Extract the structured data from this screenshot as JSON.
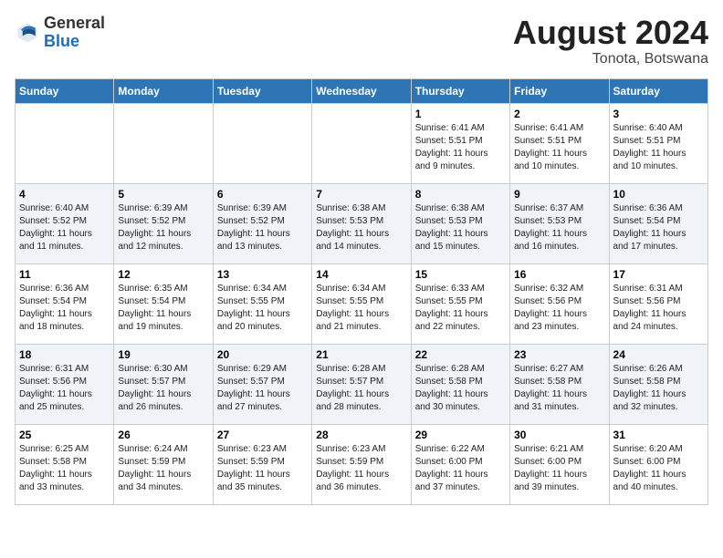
{
  "header": {
    "logo_general": "General",
    "logo_blue": "Blue",
    "month_year": "August 2024",
    "location": "Tonota, Botswana"
  },
  "days_of_week": [
    "Sunday",
    "Monday",
    "Tuesday",
    "Wednesday",
    "Thursday",
    "Friday",
    "Saturday"
  ],
  "weeks": [
    [
      {
        "day": "",
        "info": ""
      },
      {
        "day": "",
        "info": ""
      },
      {
        "day": "",
        "info": ""
      },
      {
        "day": "",
        "info": ""
      },
      {
        "day": "1",
        "info": "Sunrise: 6:41 AM\nSunset: 5:51 PM\nDaylight: 11 hours\nand 9 minutes."
      },
      {
        "day": "2",
        "info": "Sunrise: 6:41 AM\nSunset: 5:51 PM\nDaylight: 11 hours\nand 10 minutes."
      },
      {
        "day": "3",
        "info": "Sunrise: 6:40 AM\nSunset: 5:51 PM\nDaylight: 11 hours\nand 10 minutes."
      }
    ],
    [
      {
        "day": "4",
        "info": "Sunrise: 6:40 AM\nSunset: 5:52 PM\nDaylight: 11 hours\nand 11 minutes."
      },
      {
        "day": "5",
        "info": "Sunrise: 6:39 AM\nSunset: 5:52 PM\nDaylight: 11 hours\nand 12 minutes."
      },
      {
        "day": "6",
        "info": "Sunrise: 6:39 AM\nSunset: 5:52 PM\nDaylight: 11 hours\nand 13 minutes."
      },
      {
        "day": "7",
        "info": "Sunrise: 6:38 AM\nSunset: 5:53 PM\nDaylight: 11 hours\nand 14 minutes."
      },
      {
        "day": "8",
        "info": "Sunrise: 6:38 AM\nSunset: 5:53 PM\nDaylight: 11 hours\nand 15 minutes."
      },
      {
        "day": "9",
        "info": "Sunrise: 6:37 AM\nSunset: 5:53 PM\nDaylight: 11 hours\nand 16 minutes."
      },
      {
        "day": "10",
        "info": "Sunrise: 6:36 AM\nSunset: 5:54 PM\nDaylight: 11 hours\nand 17 minutes."
      }
    ],
    [
      {
        "day": "11",
        "info": "Sunrise: 6:36 AM\nSunset: 5:54 PM\nDaylight: 11 hours\nand 18 minutes."
      },
      {
        "day": "12",
        "info": "Sunrise: 6:35 AM\nSunset: 5:54 PM\nDaylight: 11 hours\nand 19 minutes."
      },
      {
        "day": "13",
        "info": "Sunrise: 6:34 AM\nSunset: 5:55 PM\nDaylight: 11 hours\nand 20 minutes."
      },
      {
        "day": "14",
        "info": "Sunrise: 6:34 AM\nSunset: 5:55 PM\nDaylight: 11 hours\nand 21 minutes."
      },
      {
        "day": "15",
        "info": "Sunrise: 6:33 AM\nSunset: 5:55 PM\nDaylight: 11 hours\nand 22 minutes."
      },
      {
        "day": "16",
        "info": "Sunrise: 6:32 AM\nSunset: 5:56 PM\nDaylight: 11 hours\nand 23 minutes."
      },
      {
        "day": "17",
        "info": "Sunrise: 6:31 AM\nSunset: 5:56 PM\nDaylight: 11 hours\nand 24 minutes."
      }
    ],
    [
      {
        "day": "18",
        "info": "Sunrise: 6:31 AM\nSunset: 5:56 PM\nDaylight: 11 hours\nand 25 minutes."
      },
      {
        "day": "19",
        "info": "Sunrise: 6:30 AM\nSunset: 5:57 PM\nDaylight: 11 hours\nand 26 minutes."
      },
      {
        "day": "20",
        "info": "Sunrise: 6:29 AM\nSunset: 5:57 PM\nDaylight: 11 hours\nand 27 minutes."
      },
      {
        "day": "21",
        "info": "Sunrise: 6:28 AM\nSunset: 5:57 PM\nDaylight: 11 hours\nand 28 minutes."
      },
      {
        "day": "22",
        "info": "Sunrise: 6:28 AM\nSunset: 5:58 PM\nDaylight: 11 hours\nand 30 minutes."
      },
      {
        "day": "23",
        "info": "Sunrise: 6:27 AM\nSunset: 5:58 PM\nDaylight: 11 hours\nand 31 minutes."
      },
      {
        "day": "24",
        "info": "Sunrise: 6:26 AM\nSunset: 5:58 PM\nDaylight: 11 hours\nand 32 minutes."
      }
    ],
    [
      {
        "day": "25",
        "info": "Sunrise: 6:25 AM\nSunset: 5:58 PM\nDaylight: 11 hours\nand 33 minutes."
      },
      {
        "day": "26",
        "info": "Sunrise: 6:24 AM\nSunset: 5:59 PM\nDaylight: 11 hours\nand 34 minutes."
      },
      {
        "day": "27",
        "info": "Sunrise: 6:23 AM\nSunset: 5:59 PM\nDaylight: 11 hours\nand 35 minutes."
      },
      {
        "day": "28",
        "info": "Sunrise: 6:23 AM\nSunset: 5:59 PM\nDaylight: 11 hours\nand 36 minutes."
      },
      {
        "day": "29",
        "info": "Sunrise: 6:22 AM\nSunset: 6:00 PM\nDaylight: 11 hours\nand 37 minutes."
      },
      {
        "day": "30",
        "info": "Sunrise: 6:21 AM\nSunset: 6:00 PM\nDaylight: 11 hours\nand 39 minutes."
      },
      {
        "day": "31",
        "info": "Sunrise: 6:20 AM\nSunset: 6:00 PM\nDaylight: 11 hours\nand 40 minutes."
      }
    ]
  ]
}
